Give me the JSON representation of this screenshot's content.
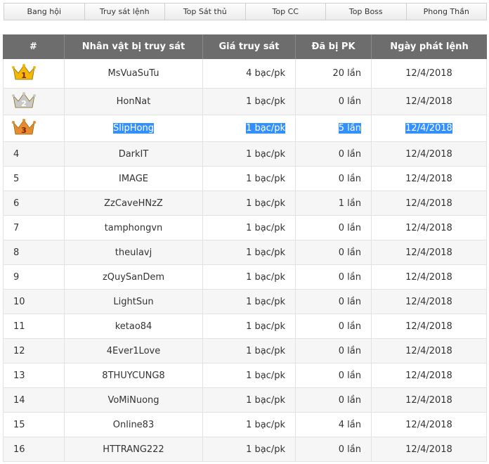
{
  "tabs": [
    "Bang hội",
    "Truy sát lệnh",
    "Top Sát thủ",
    "Top CC",
    "Top Boss",
    "Phong Thần"
  ],
  "table": {
    "headers": [
      "#",
      "Nhân vật bị truy sát",
      "Giá truy sát",
      "Đã bị PK",
      "Ngày phát lệnh"
    ],
    "rows": [
      {
        "rank": "1",
        "name": "MsVuaSuTu",
        "price": "4 bạc/pk",
        "pk": "20 lần",
        "date": "12/4/2018"
      },
      {
        "rank": "2",
        "name": "HonNat",
        "price": "1 bạc/pk",
        "pk": "0 lần",
        "date": "12/4/2018"
      },
      {
        "rank": "3",
        "name": "SlipHong",
        "price": "1 bạc/pk",
        "pk": "5 lần",
        "date": "12/4/2018"
      },
      {
        "rank": "4",
        "name": "DarkIT",
        "price": "1 bạc/pk",
        "pk": "0 lần",
        "date": "12/4/2018"
      },
      {
        "rank": "5",
        "name": "IMAGE",
        "price": "1 bạc/pk",
        "pk": "0 lần",
        "date": "12/4/2018"
      },
      {
        "rank": "6",
        "name": "ZzCaveHNzZ",
        "price": "1 bạc/pk",
        "pk": "1 lần",
        "date": "12/4/2018"
      },
      {
        "rank": "7",
        "name": "tamphongvn",
        "price": "1 bạc/pk",
        "pk": "0 lần",
        "date": "12/4/2018"
      },
      {
        "rank": "8",
        "name": "theulavj",
        "price": "1 bạc/pk",
        "pk": "0 lần",
        "date": "12/4/2018"
      },
      {
        "rank": "9",
        "name": "zQuySanDem",
        "price": "1 bạc/pk",
        "pk": "0 lần",
        "date": "12/4/2018"
      },
      {
        "rank": "10",
        "name": "LightSun",
        "price": "1 bạc/pk",
        "pk": "0 lần",
        "date": "12/4/2018"
      },
      {
        "rank": "11",
        "name": "ketao84",
        "price": "1 bạc/pk",
        "pk": "0 lần",
        "date": "12/4/2018"
      },
      {
        "rank": "12",
        "name": "4Ever1Love",
        "price": "1 bạc/pk",
        "pk": "0 lần",
        "date": "12/4/2018"
      },
      {
        "rank": "13",
        "name": "8THUYCUNG8",
        "price": "1 bạc/pk",
        "pk": "0 lần",
        "date": "12/4/2018"
      },
      {
        "rank": "14",
        "name": "VoMiNuong",
        "price": "1 bạc/pk",
        "pk": "0 lần",
        "date": "12/4/2018"
      },
      {
        "rank": "15",
        "name": "Online83",
        "price": "1 bạc/pk",
        "pk": "4 lần",
        "date": "12/4/2018"
      },
      {
        "rank": "16",
        "name": "HTTRANG222",
        "price": "1 bạc/pk",
        "pk": "0 lần",
        "date": "12/4/2018"
      }
    ]
  },
  "colors": {
    "header_bg": "#6d6d6d",
    "selection": "#3390ff",
    "gold": "#f5b800",
    "silver": "#c9c9c9",
    "bronze": "#e88a2e"
  }
}
